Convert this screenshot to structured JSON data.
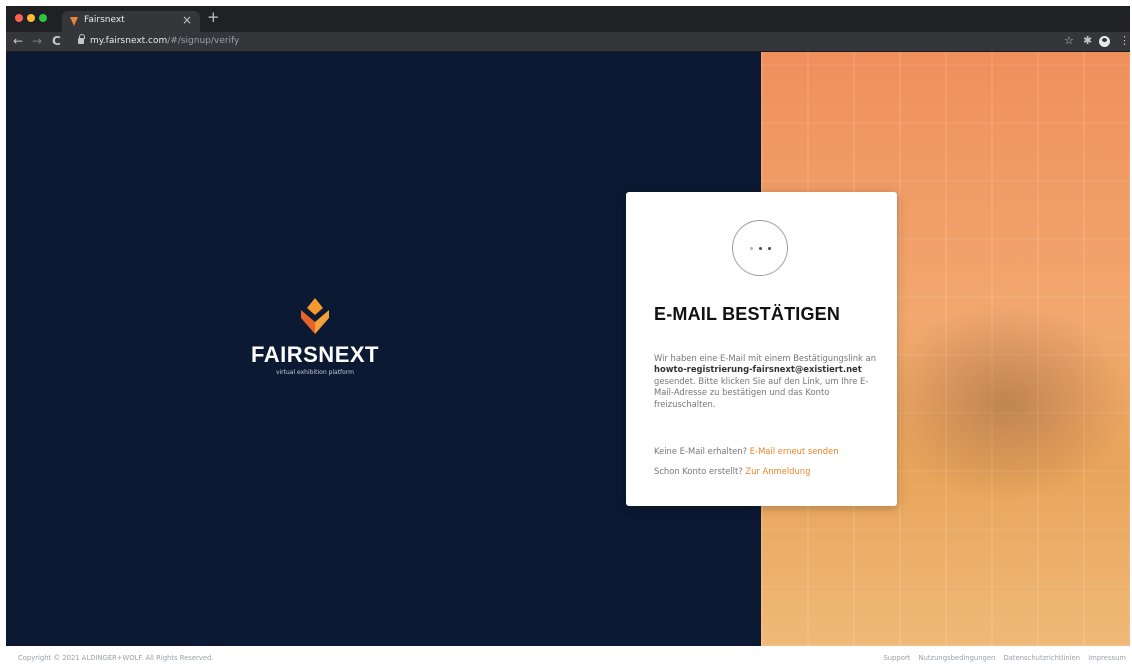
{
  "browser": {
    "tab_title": "Fairsnext",
    "tab_close": "×",
    "new_tab": "+",
    "url_host": "my.fairsnext.com",
    "url_path": "/#/signup/verify",
    "back": "←",
    "forward": "→",
    "reload": "C",
    "bookmark_star": "☆",
    "extensions": "✱",
    "menu": "⋮"
  },
  "logo": {
    "wordmark": "FAIRSNEXT",
    "tagline": "virtual exhibition platform"
  },
  "card": {
    "title": "E-MAIL BESTÄTIGEN",
    "text_before": "Wir haben eine E-Mail mit einem Bestätigungslink an",
    "email": "howto-registrierung-fairsnext@existiert.net",
    "text_after": "gesendet. Bitte klicken Sie auf den Link, um Ihre E-Mail-Adresse zu bestätigen und das Konto freizuschalten.",
    "resend_prompt": "Keine E-Mail erhalten?",
    "resend_link": "E-Mail erneut senden",
    "login_prompt": "Schon Konto erstellt?",
    "login_link": "Zur Anmeldung"
  },
  "footer": {
    "copyright": "Copyright © 2021 ALDINGER+WOLF. All Rights Reserved.",
    "links": [
      "Support",
      "Nutzungsbedingungen",
      "Datenschutzrichtlinien",
      "Impressum"
    ]
  },
  "colors": {
    "page_dark": "#0c1932",
    "accent": "#e8862a"
  }
}
